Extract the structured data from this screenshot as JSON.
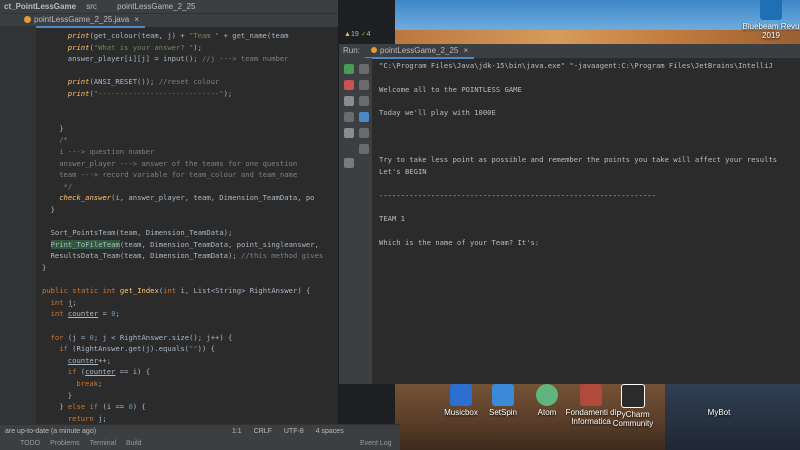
{
  "ide": {
    "project_title": "ct_PointLessGame",
    "breadcrumb_src": "src",
    "breadcrumb_file": "pointLessGame_2_25",
    "tab_file": "pointLessGame_2_25.java",
    "code_lines": [
      {
        "indent": 6,
        "parts": [
          [
            "it",
            "print"
          ],
          [
            "",
            "(get_colour(team, j) + "
          ],
          [
            "str",
            "\"Team \""
          ],
          [
            "",
            " + get_name(team"
          ]
        ]
      },
      {
        "indent": 6,
        "parts": [
          [
            "it",
            "print"
          ],
          [
            "",
            "("
          ],
          [
            "str",
            "\"What is your answer? \""
          ],
          [
            "",
            ");"
          ]
        ]
      },
      {
        "indent": 6,
        "parts": [
          [
            "",
            "answer_player[i][j] = input(); "
          ],
          [
            "cm",
            "//j ---> team number"
          ]
        ]
      },
      {
        "indent": 0,
        "parts": []
      },
      {
        "indent": 6,
        "parts": [
          [
            "it",
            "print"
          ],
          [
            "",
            "(ANSI_RESET()); "
          ],
          [
            "cm",
            "//reset colour"
          ]
        ]
      },
      {
        "indent": 6,
        "parts": [
          [
            "it",
            "print"
          ],
          [
            "",
            "("
          ],
          [
            "str",
            "\"----------------------------\""
          ],
          [
            "",
            ");"
          ]
        ]
      },
      {
        "indent": 0,
        "parts": []
      },
      {
        "indent": 0,
        "parts": []
      },
      {
        "indent": 4,
        "parts": [
          [
            "",
            "}"
          ]
        ]
      },
      {
        "indent": 4,
        "parts": [
          [
            "cm",
            "/*"
          ]
        ]
      },
      {
        "indent": 4,
        "parts": [
          [
            "cm",
            "i ---> question number"
          ]
        ]
      },
      {
        "indent": 4,
        "parts": [
          [
            "cm",
            "answer_player ---> answer of the teams for one question"
          ]
        ]
      },
      {
        "indent": 4,
        "parts": [
          [
            "cm",
            "team ---> record variable for team_colour and team_name"
          ]
        ]
      },
      {
        "indent": 4,
        "parts": [
          [
            "cm",
            " */"
          ]
        ]
      },
      {
        "indent": 4,
        "parts": [
          [
            "it",
            "check_answer"
          ],
          [
            "",
            "(i, answer_player, team, Dimension_TeamData, po"
          ]
        ]
      },
      {
        "indent": 2,
        "parts": [
          [
            "",
            "}"
          ]
        ]
      },
      {
        "indent": 0,
        "parts": []
      },
      {
        "indent": 2,
        "parts": [
          [
            "",
            "Sort_PointsTeam(team, Dimension_TeamData);"
          ]
        ]
      },
      {
        "indent": 2,
        "parts": [
          [
            "hl",
            "Print_ToFileTeam"
          ],
          [
            "",
            "(team, Dimension_TeamData, point_singleanswer,"
          ]
        ]
      },
      {
        "indent": 2,
        "parts": [
          [
            "",
            "ResultsData_Team(team, Dimension_TeamData); "
          ],
          [
            "cm",
            "//this method gives"
          ]
        ]
      },
      {
        "indent": 0,
        "parts": [
          [
            "",
            "}"
          ]
        ]
      },
      {
        "indent": 0,
        "parts": []
      },
      {
        "indent": 0,
        "parts": [
          [
            "kw",
            "public static int "
          ],
          [
            "fn",
            "get_Index"
          ],
          [
            "",
            "("
          ],
          [
            "kw",
            "int "
          ],
          [
            "",
            "i, List<String> RightAnswer) {"
          ]
        ]
      },
      {
        "indent": 2,
        "parts": [
          [
            "kw",
            "int "
          ],
          [
            "und",
            "j"
          ],
          [
            "",
            ";"
          ]
        ]
      },
      {
        "indent": 2,
        "parts": [
          [
            "kw",
            "int "
          ],
          [
            "und",
            "counter"
          ],
          [
            "",
            " = "
          ],
          [
            "num",
            "0"
          ],
          [
            "",
            ";"
          ]
        ]
      },
      {
        "indent": 0,
        "parts": []
      },
      {
        "indent": 2,
        "parts": [
          [
            "kw",
            "for "
          ],
          [
            "",
            "(j = "
          ],
          [
            "num",
            "0"
          ],
          [
            "",
            "; j < RightAnswer.size(); j++) {"
          ]
        ]
      },
      {
        "indent": 4,
        "parts": [
          [
            "kw",
            "if "
          ],
          [
            "",
            "(RightAnswer.get(j).equals("
          ],
          [
            "str",
            "\"\""
          ],
          [
            "",
            ")) {"
          ]
        ]
      },
      {
        "indent": 6,
        "parts": [
          [
            "und",
            "counter"
          ],
          [
            "",
            "++;"
          ]
        ]
      },
      {
        "indent": 6,
        "parts": [
          [
            "kw",
            "if "
          ],
          [
            "",
            "("
          ],
          [
            "und",
            "counter"
          ],
          [
            "",
            " == i) {"
          ]
        ]
      },
      {
        "indent": 8,
        "parts": [
          [
            "kw",
            "break"
          ],
          [
            "",
            ";"
          ]
        ]
      },
      {
        "indent": 6,
        "parts": [
          [
            "",
            "}"
          ]
        ]
      },
      {
        "indent": 4,
        "parts": [
          [
            "",
            "} "
          ],
          [
            "kw",
            "else if "
          ],
          [
            "",
            "(i == "
          ],
          [
            "num",
            "0"
          ],
          [
            "",
            ") {"
          ]
        ]
      },
      {
        "indent": 6,
        "parts": [
          [
            "kw",
            "return "
          ],
          [
            "",
            "j;"
          ]
        ]
      }
    ],
    "status_message": "are up-to-date (a minute ago)",
    "position": "1:1",
    "line_sep": "CRLF",
    "encoding": "UTF-8",
    "indent": "4 spaces",
    "bottom_tabs": [
      "TODO",
      "Problems",
      "Terminal",
      "Build"
    ],
    "event_log": "Event Log",
    "warning_count": "19",
    "check_count": "4"
  },
  "run": {
    "label": "Run:",
    "tab": "pointLessGame_2_25",
    "console_lines": [
      "\"C:\\Program Files\\Java\\jdk-15\\bin\\java.exe\" \"-javaagent:C:\\Program Files\\JetBrains\\IntelliJ",
      "",
      "Welcome all to the POINTLESS GAME",
      "",
      "Today we'll play with 1000E",
      "",
      "",
      "",
      "Try to take less point as possible and remember the points you take will affect your results",
      "Let's BEGIN",
      "",
      "----------------------------------------------------------------",
      "",
      "TEAM 1",
      "",
      "Which is the name of your Team? It's:"
    ]
  },
  "desktop": {
    "icons": [
      {
        "label": "Bluebeam Revu 2019",
        "color": "#1f6fb5"
      },
      {
        "label": "Musicbox",
        "color": "#2d6fd1"
      },
      {
        "label": "SetSpin",
        "color": "#3a8ad8"
      },
      {
        "label": "Atom",
        "color": "#5fb57d"
      },
      {
        "label": "Fondamenti di Informatica",
        "color": "#b04a3a"
      },
      {
        "label": "PyCharm Community",
        "color": "#2b2b2b"
      },
      {
        "label": "MyBot",
        "color": "#777777"
      }
    ]
  }
}
